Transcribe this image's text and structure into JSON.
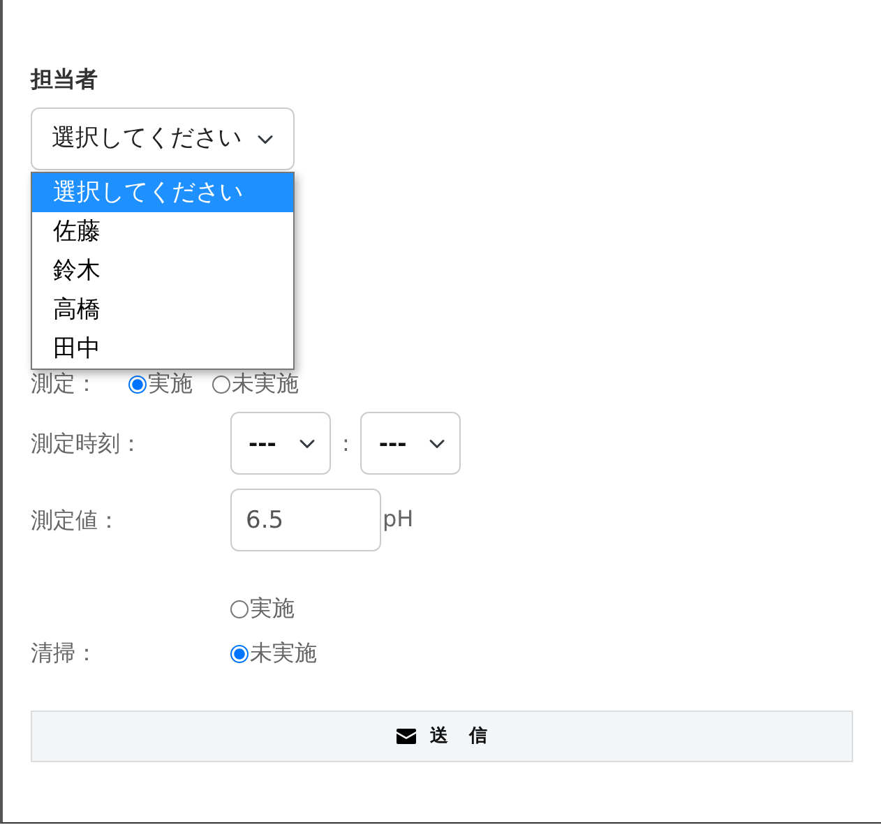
{
  "assignee": {
    "label": "担当者",
    "value": "選択してください",
    "expanded": true,
    "options": [
      {
        "label": "選択してください",
        "selected": true
      },
      {
        "label": "佐藤",
        "selected": false
      },
      {
        "label": "鈴木",
        "selected": false
      },
      {
        "label": "高橋",
        "selected": false
      },
      {
        "label": "田中",
        "selected": false
      }
    ]
  },
  "measurement": {
    "label": "測定：",
    "options": [
      {
        "label": "実施",
        "selected": true
      },
      {
        "label": "未実施",
        "selected": false
      }
    ]
  },
  "time": {
    "label": "測定時刻：",
    "hour": "---",
    "separator": ":",
    "minute": "---"
  },
  "reading": {
    "label": "測定値：",
    "value": "6.5",
    "unit": "pH"
  },
  "cleaning": {
    "label": "清掃：",
    "options": [
      {
        "label": "実施",
        "selected": false
      },
      {
        "label": "未実施",
        "selected": true
      }
    ]
  },
  "submit": "送 信"
}
